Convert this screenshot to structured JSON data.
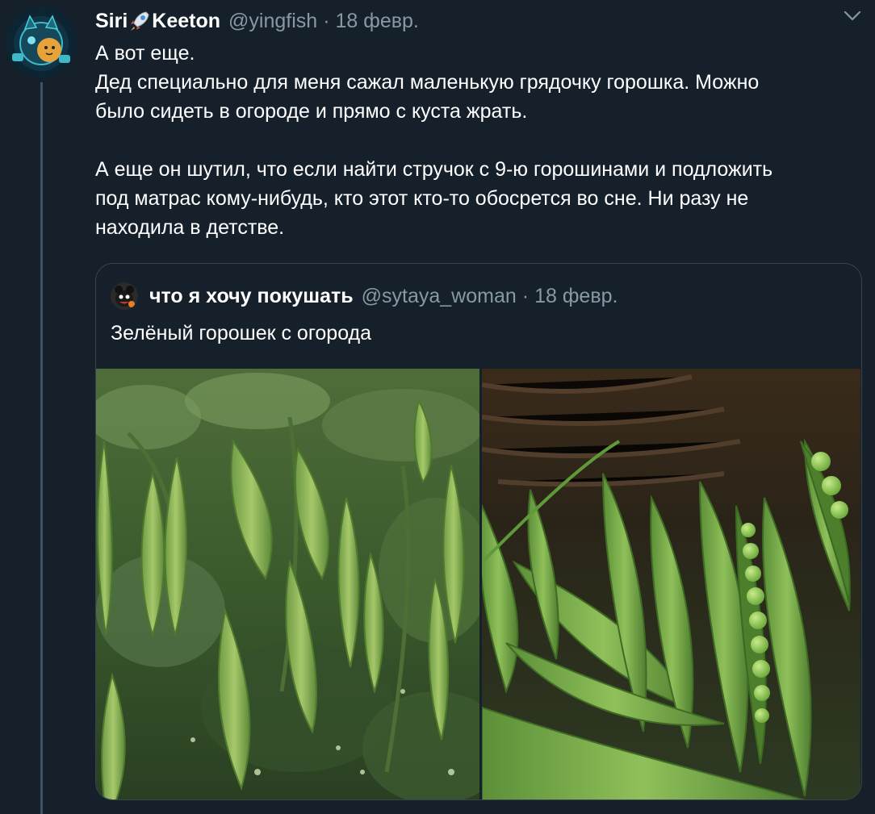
{
  "tweet": {
    "author_name_part1": "Siri",
    "author_name_part2": "Keeton",
    "author_emoji_icon": "rocket-icon",
    "handle": "@yingfish",
    "separator": "·",
    "date": "18 февр.",
    "lines": [
      "А вот еще.",
      "Дед специально для меня сажал маленькую грядочку горошка. Можно",
      "было сидеть в огороде и прямо с куста жрать.",
      "",
      "А еще он шутил, что если найти стручок с 9-ю горошинами и подложить",
      "под матрас кому-нибудь, кто этот кто-то обосрется во сне. Ни разу не",
      "находила в детстве."
    ]
  },
  "quoted_tweet": {
    "author_name": "что я хочу покушать",
    "handle": "@sytaya_woman",
    "separator": "·",
    "date": "18 февр.",
    "text": "Зелёный горошек с огорода",
    "media": [
      {
        "description_icon": "pea-plants-photo"
      },
      {
        "description_icon": "pea-pods-basket-photo"
      }
    ]
  },
  "colors": {
    "background": "#15202b",
    "secondary_text": "#8899a6",
    "border": "#38444d",
    "thread_line": "#3d5466"
  }
}
